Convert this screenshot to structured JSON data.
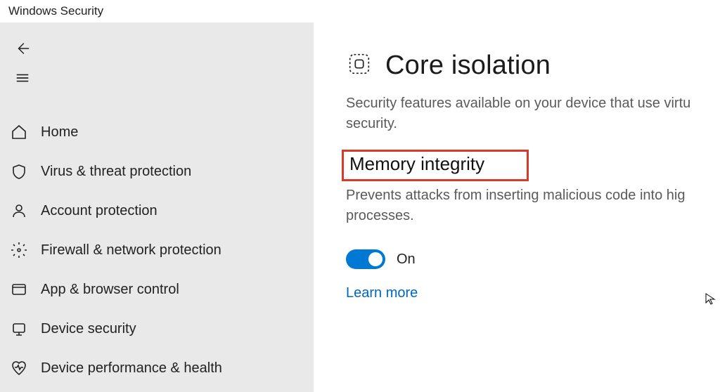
{
  "window_title": "Windows Security",
  "sidebar": {
    "items": [
      {
        "label": "Home"
      },
      {
        "label": "Virus & threat protection"
      },
      {
        "label": "Account protection"
      },
      {
        "label": "Firewall & network protection"
      },
      {
        "label": "App & browser control"
      },
      {
        "label": "Device security"
      },
      {
        "label": "Device performance & health"
      }
    ]
  },
  "main": {
    "title": "Core isolation",
    "description": "Security features available on your device that use virtu security.",
    "section_title": "Memory integrity",
    "section_description": "Prevents attacks from inserting malicious code into hig processes.",
    "toggle_state_label": "On",
    "toggle_on": true,
    "learn_more": "Learn more"
  },
  "colors": {
    "accent": "#0078d4",
    "link": "#0067c0",
    "annotation_red": "#d53a2a"
  }
}
